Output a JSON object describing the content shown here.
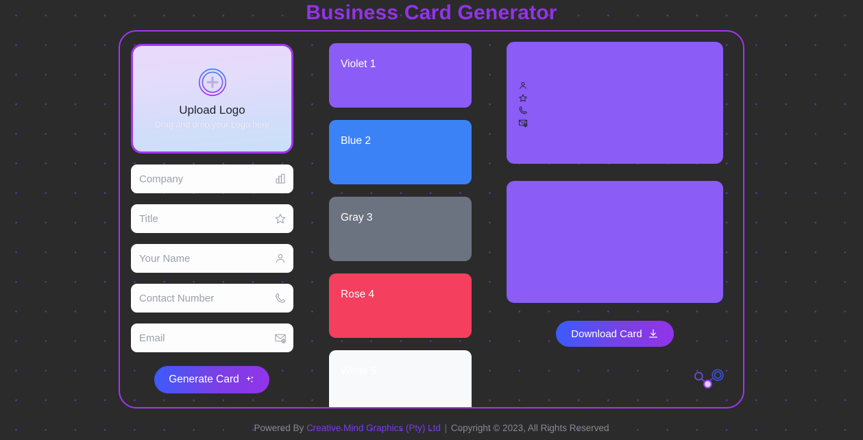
{
  "page": {
    "title": "Business Card Generator",
    "accent_purple": "#a435f0",
    "title_color": "#9333ea",
    "background_color": "#2b2b2b",
    "dot_color": "#5b3aa8"
  },
  "upload": {
    "title": "Upload Logo",
    "subtitle": "Drag and drop your Logo here",
    "icon": "circle-plus-icon"
  },
  "form": {
    "fields": [
      {
        "name": "company",
        "placeholder": "Company",
        "value": "",
        "icon": "building-icon"
      },
      {
        "name": "title",
        "placeholder": "Title",
        "value": "",
        "icon": "star-icon"
      },
      {
        "name": "your-name",
        "placeholder": "Your Name",
        "value": "",
        "icon": "person-icon"
      },
      {
        "name": "contact-number",
        "placeholder": "Contact Number",
        "value": "",
        "icon": "phone-icon"
      },
      {
        "name": "email",
        "placeholder": "Email",
        "value": "",
        "icon": "envelope-at-icon"
      }
    ],
    "generate_label": "Generate Card",
    "generate_icon": "sparkles-icon"
  },
  "swatches": [
    {
      "label": "Violet 1",
      "color": "#8b5cf6",
      "text_color": "#ffffff"
    },
    {
      "label": "Blue 2",
      "color": "#3b82f6",
      "text_color": "#ffffff"
    },
    {
      "label": "Gray 3",
      "color": "#6b7280",
      "text_color": "#ffffff"
    },
    {
      "label": "Rose 4",
      "color": "#f43f5e",
      "text_color": "#ffffff"
    },
    {
      "label": "White 5",
      "color": "#f8f9fb",
      "text_color": "#ffffff"
    }
  ],
  "preview": {
    "front_card": {
      "color": "#8b5cf6",
      "icons": [
        "person-icon",
        "star-icon",
        "phone-icon",
        "envelope-at-icon"
      ]
    },
    "back_card": {
      "color": "#8b5cf6"
    },
    "download_label": "Download Card",
    "download_icon": "download-icon",
    "brand_mark": "molecule-logo-icon"
  },
  "footer": {
    "prefix": "Powered By ",
    "brand": "Creative Mind Graphics (Pty) Ltd",
    "separator": " | ",
    "copyright": "Copyright © 2023, All Rights Reserved"
  }
}
